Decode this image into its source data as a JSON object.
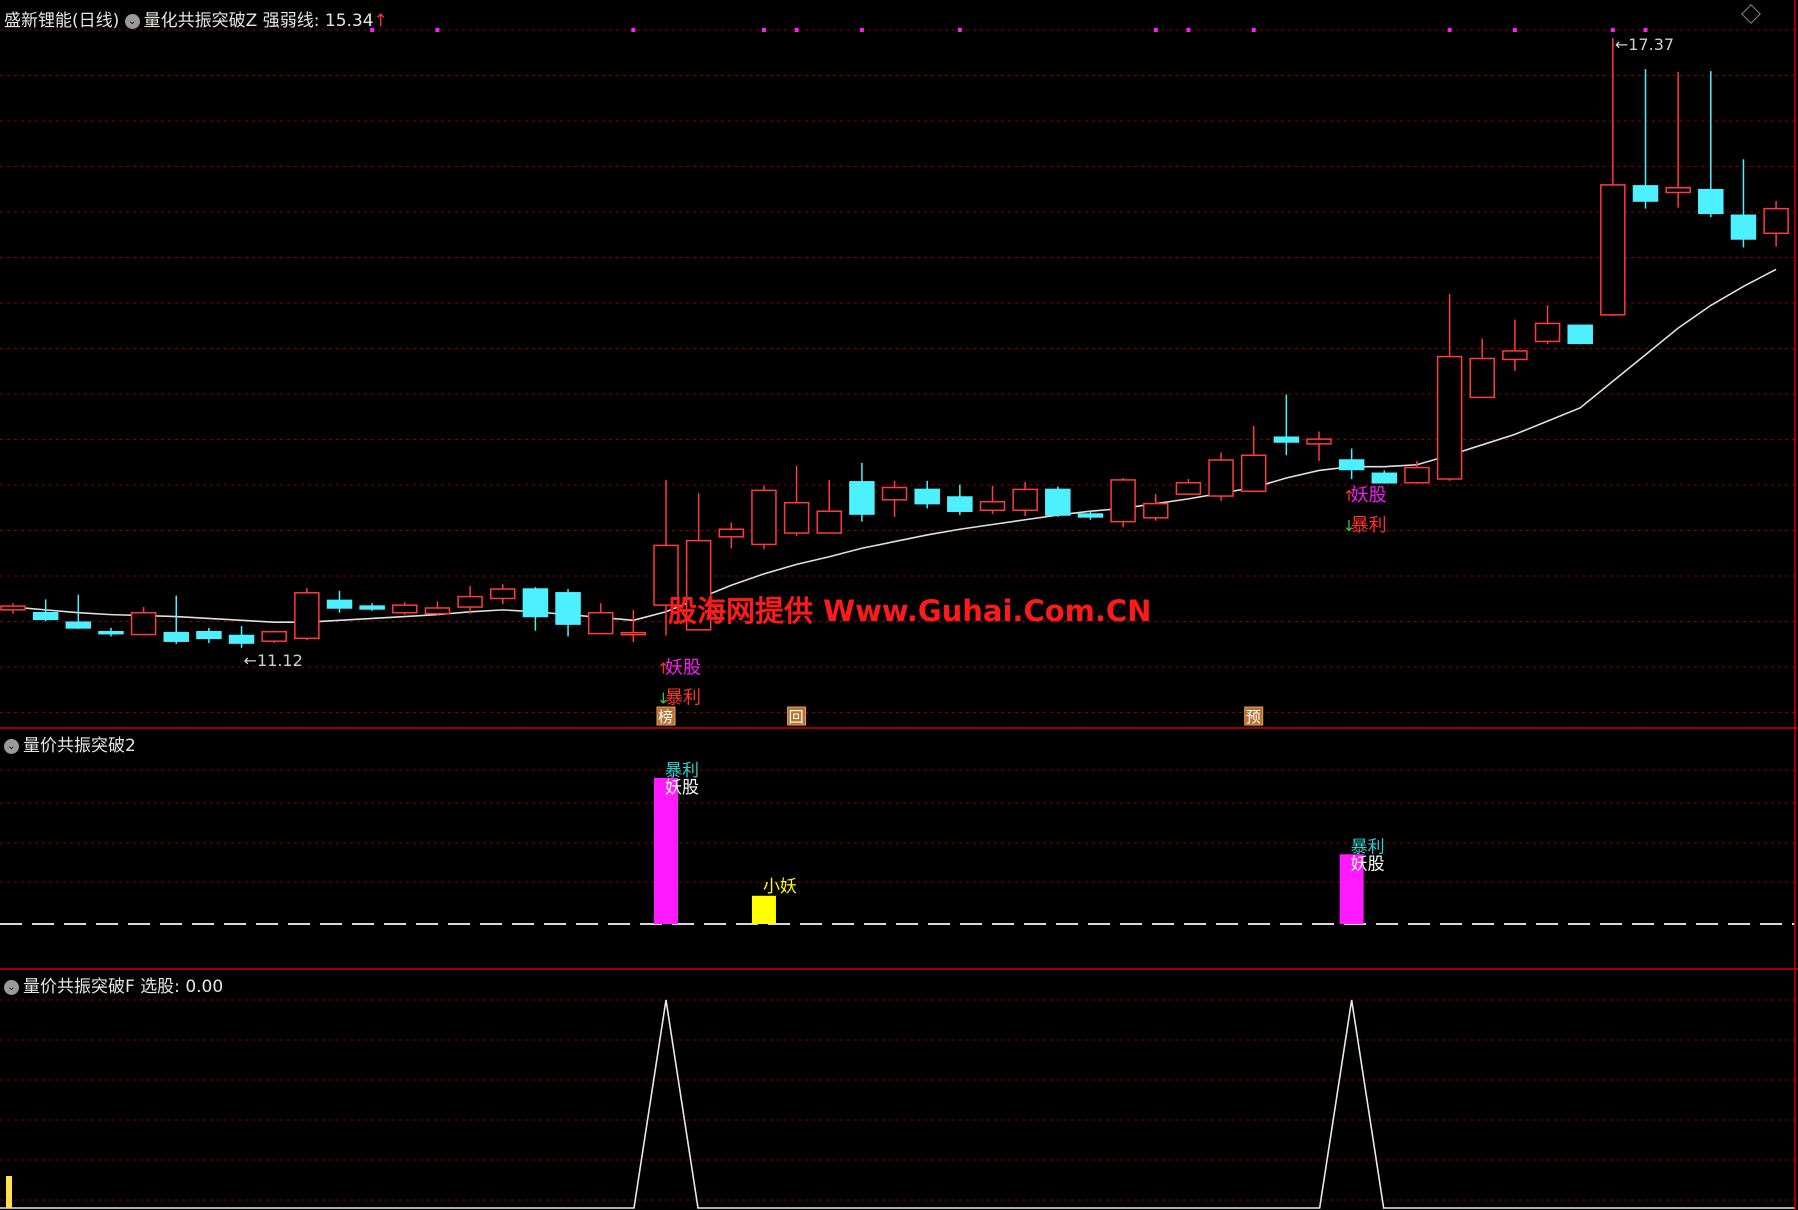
{
  "header": {
    "stock_name": "盛新锂能(日线)",
    "indicator_main": "量化共振突破Z",
    "line_label": "强弱线:",
    "line_value": "15.34",
    "line_arrow": "↑"
  },
  "pane2": {
    "title": "量价共振突破2"
  },
  "pane3": {
    "title": "量价共振突破F",
    "value_label": "选股:",
    "value": "0.00"
  },
  "watermark": "股海网提供 Www.Guhai.Com.CN",
  "colors": {
    "up": "#ff3b3b",
    "down": "#4df0ff",
    "ma": "#e0e0e0",
    "grid": "#8a0000",
    "magenta": "#ff1aff",
    "yellow": "#ffff00",
    "label_red": "#ff3030"
  },
  "chart_data": [
    {
      "type": "candlestick",
      "title": "量化共振突破Z",
      "series_line_name": "强弱线",
      "ylim": [
        10.6,
        17.8
      ],
      "x": [
        1,
        2,
        3,
        4,
        5,
        6,
        7,
        8,
        9,
        10,
        11,
        12,
        13,
        14,
        15,
        16,
        17,
        18,
        19,
        20,
        21,
        22,
        23,
        24,
        25,
        26,
        27,
        28,
        29,
        30,
        31,
        32,
        33,
        34,
        35,
        36,
        37,
        38,
        39,
        40,
        41,
        42,
        43,
        44,
        45,
        46,
        47,
        48,
        49,
        50,
        51,
        52,
        53,
        54,
        55
      ],
      "open": [
        11.55,
        11.52,
        11.42,
        11.32,
        11.29,
        11.31,
        11.32,
        11.28,
        11.22,
        11.25,
        11.65,
        11.59,
        11.52,
        11.51,
        11.58,
        11.67,
        11.77,
        11.73,
        11.3,
        11.29,
        11.6,
        11.34,
        12.32,
        12.24,
        12.36,
        12.36,
        12.9,
        12.71,
        12.82,
        12.74,
        12.6,
        12.6,
        12.82,
        12.56,
        12.48,
        12.52,
        12.77,
        12.75,
        12.8,
        13.37,
        13.3,
        13.13,
        12.99,
        12.89,
        12.93,
        13.79,
        14.19,
        14.38,
        14.55,
        14.66,
        16.02,
        15.95,
        15.98,
        15.71,
        15.52
      ],
      "close": [
        11.59,
        11.45,
        11.36,
        11.3,
        11.52,
        11.22,
        11.25,
        11.2,
        11.32,
        11.73,
        11.57,
        11.56,
        11.6,
        11.57,
        11.69,
        11.77,
        11.48,
        11.4,
        11.52,
        11.31,
        12.23,
        12.28,
        12.4,
        12.81,
        12.68,
        12.59,
        12.56,
        12.84,
        12.67,
        12.59,
        12.69,
        12.82,
        12.55,
        12.53,
        12.92,
        12.67,
        12.89,
        13.13,
        13.18,
        13.32,
        13.35,
        13.03,
        12.89,
        13.05,
        14.22,
        14.2,
        14.28,
        14.57,
        14.36,
        16.03,
        15.86,
        16.0,
        15.73,
        15.46,
        15.78
      ],
      "high": [
        11.62,
        11.66,
        11.71,
        11.36,
        11.58,
        11.7,
        11.36,
        11.38,
        11.33,
        11.78,
        11.75,
        11.62,
        11.63,
        11.64,
        11.8,
        11.82,
        11.79,
        11.77,
        11.62,
        11.55,
        12.92,
        12.78,
        12.47,
        12.86,
        13.07,
        12.92,
        13.1,
        12.91,
        12.91,
        12.87,
        12.86,
        12.9,
        12.85,
        12.6,
        12.94,
        12.77,
        12.93,
        13.21,
        13.49,
        13.82,
        13.43,
        13.25,
        13.02,
        13.12,
        14.88,
        14.41,
        14.61,
        14.76,
        14.55,
        17.58,
        17.25,
        17.22,
        17.23,
        16.3,
        15.86
      ],
      "low": [
        11.51,
        11.43,
        11.35,
        11.27,
        11.29,
        11.19,
        11.2,
        11.15,
        11.2,
        11.23,
        11.52,
        11.54,
        11.5,
        11.49,
        11.51,
        11.61,
        11.33,
        11.27,
        11.31,
        11.21,
        11.28,
        12.24,
        12.2,
        12.19,
        12.33,
        12.39,
        12.48,
        12.53,
        12.62,
        12.55,
        12.56,
        12.54,
        12.53,
        12.5,
        12.42,
        12.49,
        12.82,
        12.7,
        12.8,
        13.18,
        13.12,
        12.93,
        12.88,
        12.88,
        12.91,
        14.03,
        14.07,
        14.35,
        14.35,
        14.65,
        15.78,
        15.79,
        15.69,
        15.37,
        15.38
      ],
      "ma": [
        11.58,
        11.55,
        11.52,
        11.5,
        11.49,
        11.48,
        11.46,
        11.44,
        11.42,
        11.42,
        11.44,
        11.46,
        11.48,
        11.5,
        11.53,
        11.55,
        11.53,
        11.5,
        11.47,
        11.44,
        11.53,
        11.67,
        11.81,
        11.93,
        12.03,
        12.11,
        12.2,
        12.27,
        12.34,
        12.4,
        12.45,
        12.5,
        12.55,
        12.59,
        12.62,
        12.67,
        12.72,
        12.78,
        12.84,
        12.94,
        13.02,
        13.06,
        13.06,
        13.08,
        13.18,
        13.29,
        13.4,
        13.54,
        13.68,
        13.96,
        14.24,
        14.52,
        14.76,
        14.96,
        15.14
      ],
      "annotations": [
        {
          "text": "11.12",
          "marker": "←"
        },
        {
          "text": "17.37",
          "marker": "←"
        },
        {
          "text": "妖股",
          "arrow": "up",
          "bar": 21
        },
        {
          "text": "暴利",
          "arrow": "down",
          "bar": 21
        },
        {
          "text": "妖股",
          "arrow": "up",
          "bar": 42
        },
        {
          "text": "暴利",
          "arrow": "down",
          "bar": 42
        }
      ],
      "bottom_tags": [
        {
          "text": "榜",
          "bar": 21
        },
        {
          "text": "回",
          "bar": 25
        },
        {
          "text": "预",
          "bar": 39
        }
      ],
      "top_dots_bars": [
        12,
        14,
        20,
        24,
        25,
        27,
        30,
        36,
        37,
        39,
        45,
        47,
        50,
        51
      ]
    },
    {
      "type": "bar",
      "title": "量价共振突破2",
      "ylim": [
        0,
        1
      ],
      "bars": [
        {
          "bar": 21,
          "value": 0.88,
          "color": "magenta",
          "labels": [
            "暴利",
            "妖股"
          ]
        },
        {
          "bar": 24,
          "value": 0.17,
          "color": "yellow",
          "labels": [
            "小妖"
          ]
        },
        {
          "bar": 42,
          "value": 0.42,
          "color": "magenta",
          "labels": [
            "暴利",
            "妖股"
          ]
        }
      ]
    },
    {
      "type": "line",
      "title": "量价共振突破F",
      "series_name": "选股",
      "ylim": [
        0,
        1
      ],
      "spikes": [
        21,
        42
      ],
      "spike_value": 1.0,
      "current_value": 0.0
    }
  ]
}
